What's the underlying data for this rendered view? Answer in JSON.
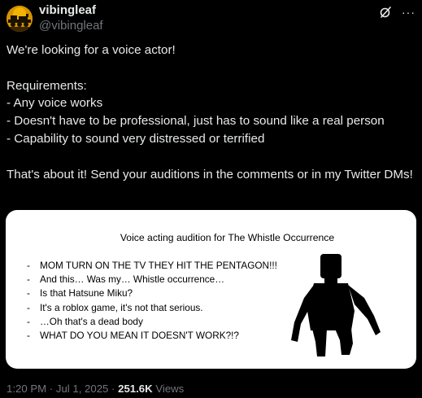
{
  "author": {
    "display_name": "vibingleaf",
    "handle": "@vibingleaf",
    "avatar_icon": "avatar-train-silhouette"
  },
  "header_actions": {
    "grok_icon": "grok-icon",
    "more_label": "···"
  },
  "post": {
    "text": "We're looking for a voice actor!\n\nRequirements:\n- Any voice works\n- Doesn't have to be professional, just has to sound like a real person\n- Capability to sound very distressed or terrified\n\nThat's about it! Send your auditions in the comments or in my Twitter DMs!"
  },
  "media": {
    "title": "Voice acting audition for The Whistle Occurrence",
    "lines": [
      "MOM TURN ON THE TV THEY HIT THE PENTAGON!!!",
      "And this… Was my… Whistle occurrence…",
      "Is that Hatsune Miku?",
      "It's a roblox game, it's not that serious.",
      "…Oh that's a dead body",
      "WHAT DO YOU MEAN IT DOESN'T WORK?!?"
    ],
    "bullet": "-",
    "figure_icon": "black-silhouette-figure"
  },
  "meta": {
    "time": "1:20 PM",
    "separator": " · ",
    "date": "Jul 1, 2025",
    "views_count": "251.6K",
    "views_label": "Views"
  },
  "colors": {
    "background": "#000000",
    "primary_text": "#e7e9ea",
    "secondary_text": "#71767b",
    "avatar": "#d69200"
  }
}
